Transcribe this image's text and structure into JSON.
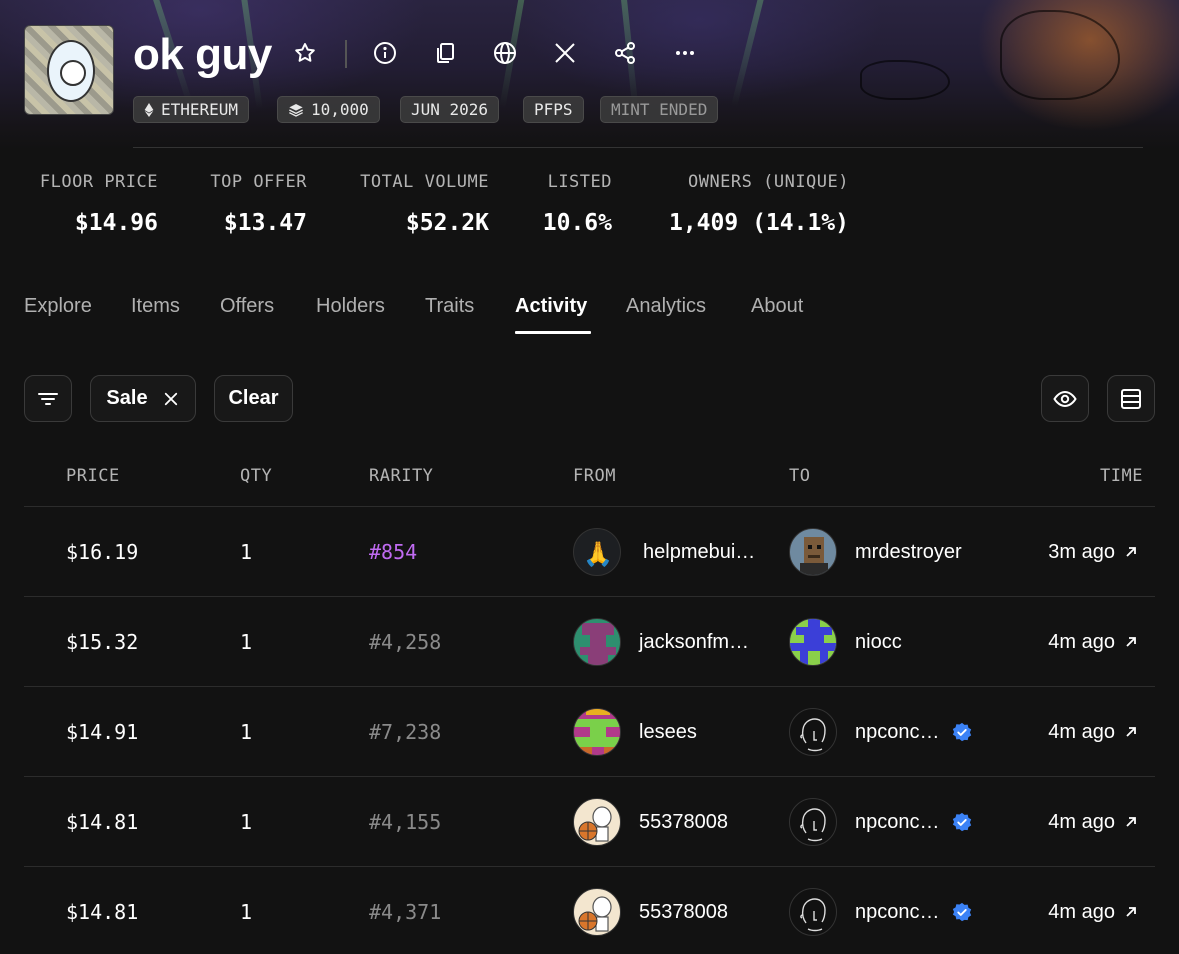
{
  "collection": {
    "name": "ok guy",
    "tags": [
      {
        "label": "ETHEREUM",
        "icon": "ethereum-icon"
      },
      {
        "label": "10,000",
        "icon": "layers-icon"
      },
      {
        "label": "JUN 2026"
      },
      {
        "label": "PFPS"
      },
      {
        "label": "MINT ENDED",
        "dim": true
      }
    ]
  },
  "header_icons": [
    "star-icon",
    "info-icon",
    "copy-icon",
    "globe-icon",
    "x-icon",
    "share-icon",
    "more-icon"
  ],
  "stats": [
    {
      "label": "FLOOR PRICE",
      "value": "$14.96"
    },
    {
      "label": "TOP OFFER",
      "value": "$13.47"
    },
    {
      "label": "TOTAL VOLUME",
      "value": "$52.2K"
    },
    {
      "label": "LISTED",
      "value": "10.6%"
    },
    {
      "label": "OWNERS (UNIQUE)",
      "value": "1,409 (14.1%)"
    }
  ],
  "tabs": [
    "Explore",
    "Items",
    "Offers",
    "Holders",
    "Traits",
    "Activity",
    "Analytics",
    "About"
  ],
  "active_tab": "Activity",
  "filters": {
    "chip_label": "Sale",
    "clear_label": "Clear"
  },
  "table": {
    "headers": {
      "price": "PRICE",
      "qty": "QTY",
      "rarity": "RARITY",
      "from": "FROM",
      "to": "TO",
      "time": "TIME"
    },
    "rows": [
      {
        "price": "$16.19",
        "qty": "1",
        "rarity": "#854",
        "from": "helpmebui…",
        "to": "mrdestroyer",
        "to_verified": false,
        "time": "3m ago"
      },
      {
        "price": "$15.32",
        "qty": "1",
        "rarity": "#4,258",
        "from": "jacksonfm…",
        "to": "niocc",
        "to_verified": false,
        "time": "4m ago"
      },
      {
        "price": "$14.91",
        "qty": "1",
        "rarity": "#7,238",
        "from": "lesees",
        "to": "npconc…",
        "to_verified": true,
        "time": "4m ago"
      },
      {
        "price": "$14.81",
        "qty": "1",
        "rarity": "#4,155",
        "from": "55378008",
        "to": "npconc…",
        "to_verified": true,
        "time": "4m ago"
      },
      {
        "price": "$14.81",
        "qty": "1",
        "rarity": "#4,371",
        "from": "55378008",
        "to": "npconc…",
        "to_verified": true,
        "time": "4m ago"
      }
    ]
  },
  "colors": {
    "background": "#121212",
    "rarity_highlight": "#c06bf2",
    "verified": "#3b82f6"
  }
}
